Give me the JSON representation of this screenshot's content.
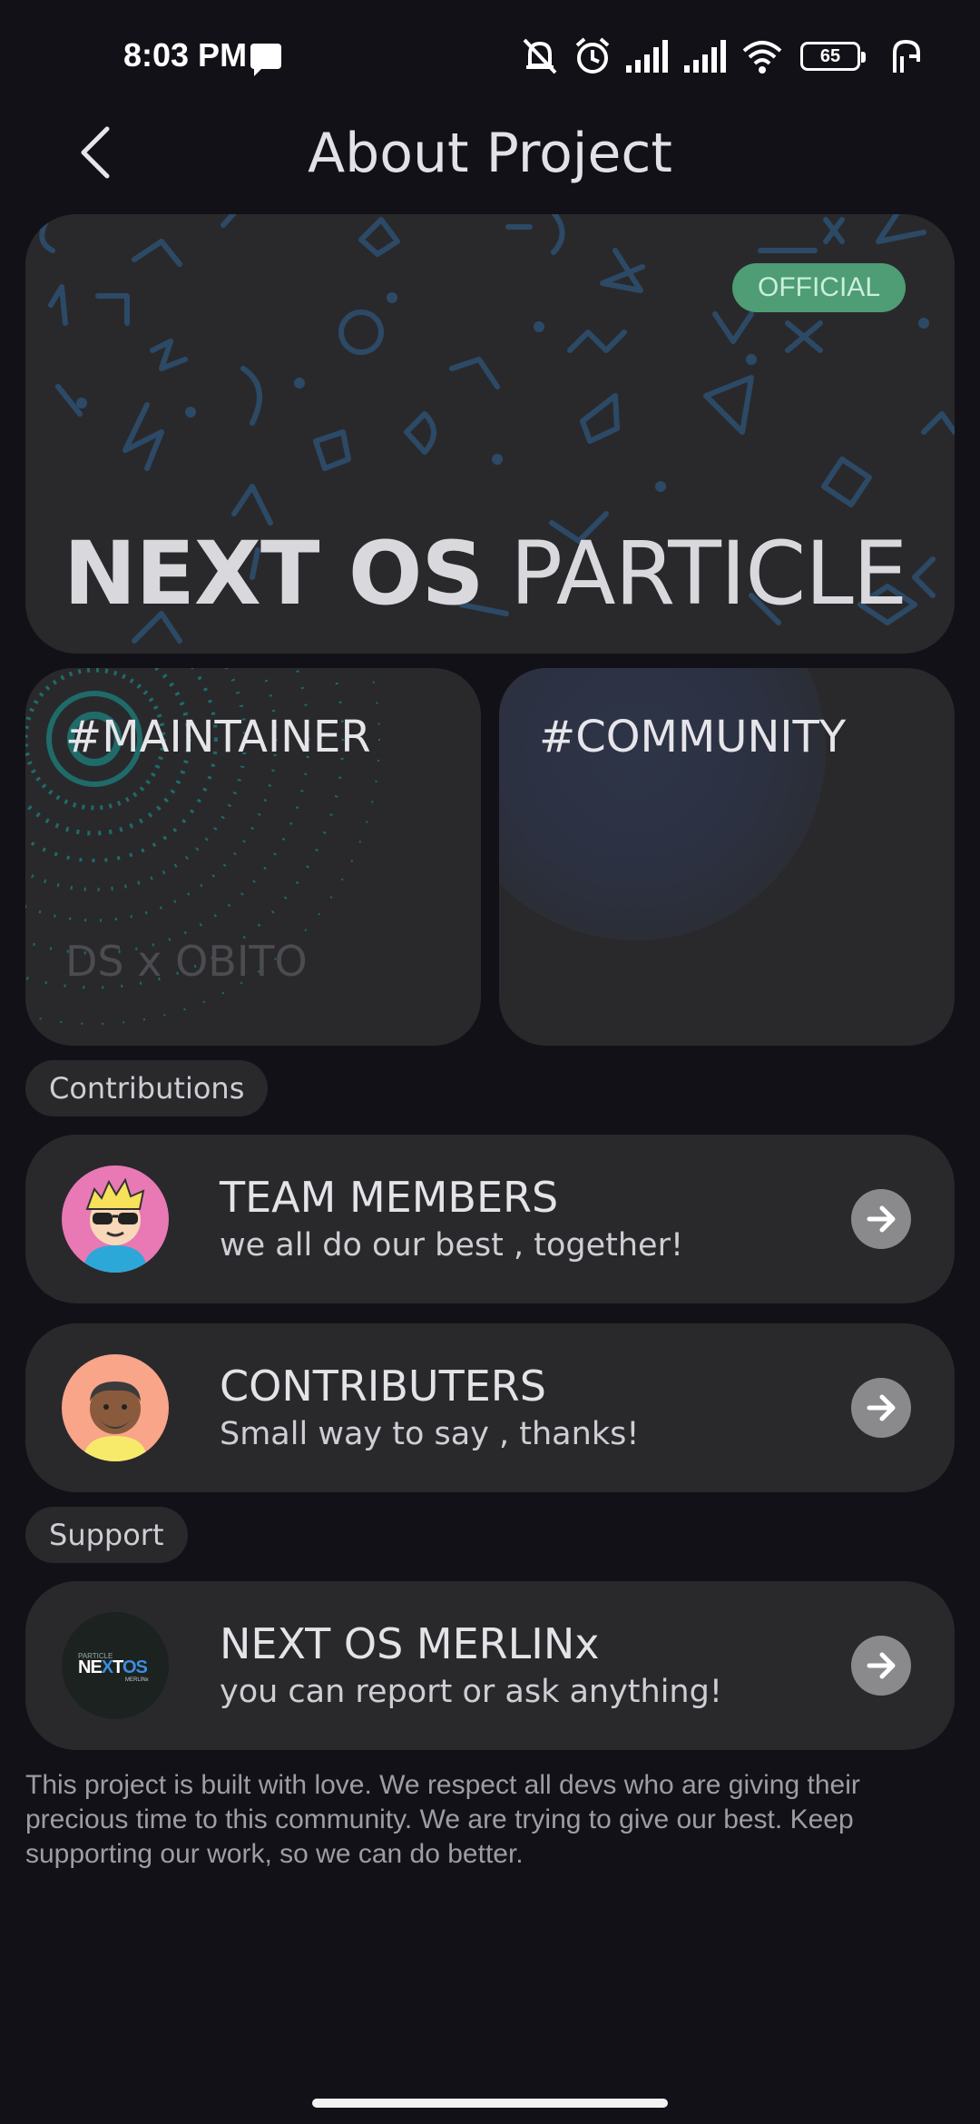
{
  "status_bar": {
    "time": "8:03 PM",
    "battery": "65",
    "icons": [
      "message-icon",
      "silent-icon",
      "alarm-icon",
      "signal-icon",
      "signal-icon",
      "wifi-icon",
      "battery-icon",
      "hand-icon"
    ]
  },
  "header": {
    "title": "About Project",
    "back_icon": "chevron-left-icon"
  },
  "hero": {
    "badge": "OFFICIAL",
    "title_bold": "NEXT OS",
    "title_light": "PARTICLE"
  },
  "cards": {
    "maintainer": {
      "tag": "#MAINTAINER",
      "sub": "DS x OBITO"
    },
    "community": {
      "tag": "#COMMUNITY"
    }
  },
  "sections": {
    "contributions": "Contributions",
    "support": "Support"
  },
  "rows": [
    {
      "title": "TEAM MEMBERS",
      "subtitle": "we all do our best , together!",
      "icon": "arrow-right-icon"
    },
    {
      "title": "CONTRIBUTERS",
      "subtitle": "Small way to say , thanks!",
      "icon": "arrow-right-icon"
    },
    {
      "title": "NEXT OS MERLINx",
      "subtitle": "you can report or ask anything!",
      "icon": "arrow-right-icon"
    }
  ],
  "logo": {
    "text_main_1": "NE",
    "text_main_2": "X",
    "text_main_3": "T",
    "text_main_4": "OS",
    "text_small": "MERLINx",
    "text_top": "PARTICLE"
  },
  "footer": "This project is built with love. We respect all devs who are giving their precious time to this community. We are trying to give our best. Keep supporting our work, so we can do better.",
  "colors": {
    "background": "#131118",
    "card": "#29292c",
    "badge": "#4e9d74",
    "arrow_button": "#8a8a8d"
  }
}
